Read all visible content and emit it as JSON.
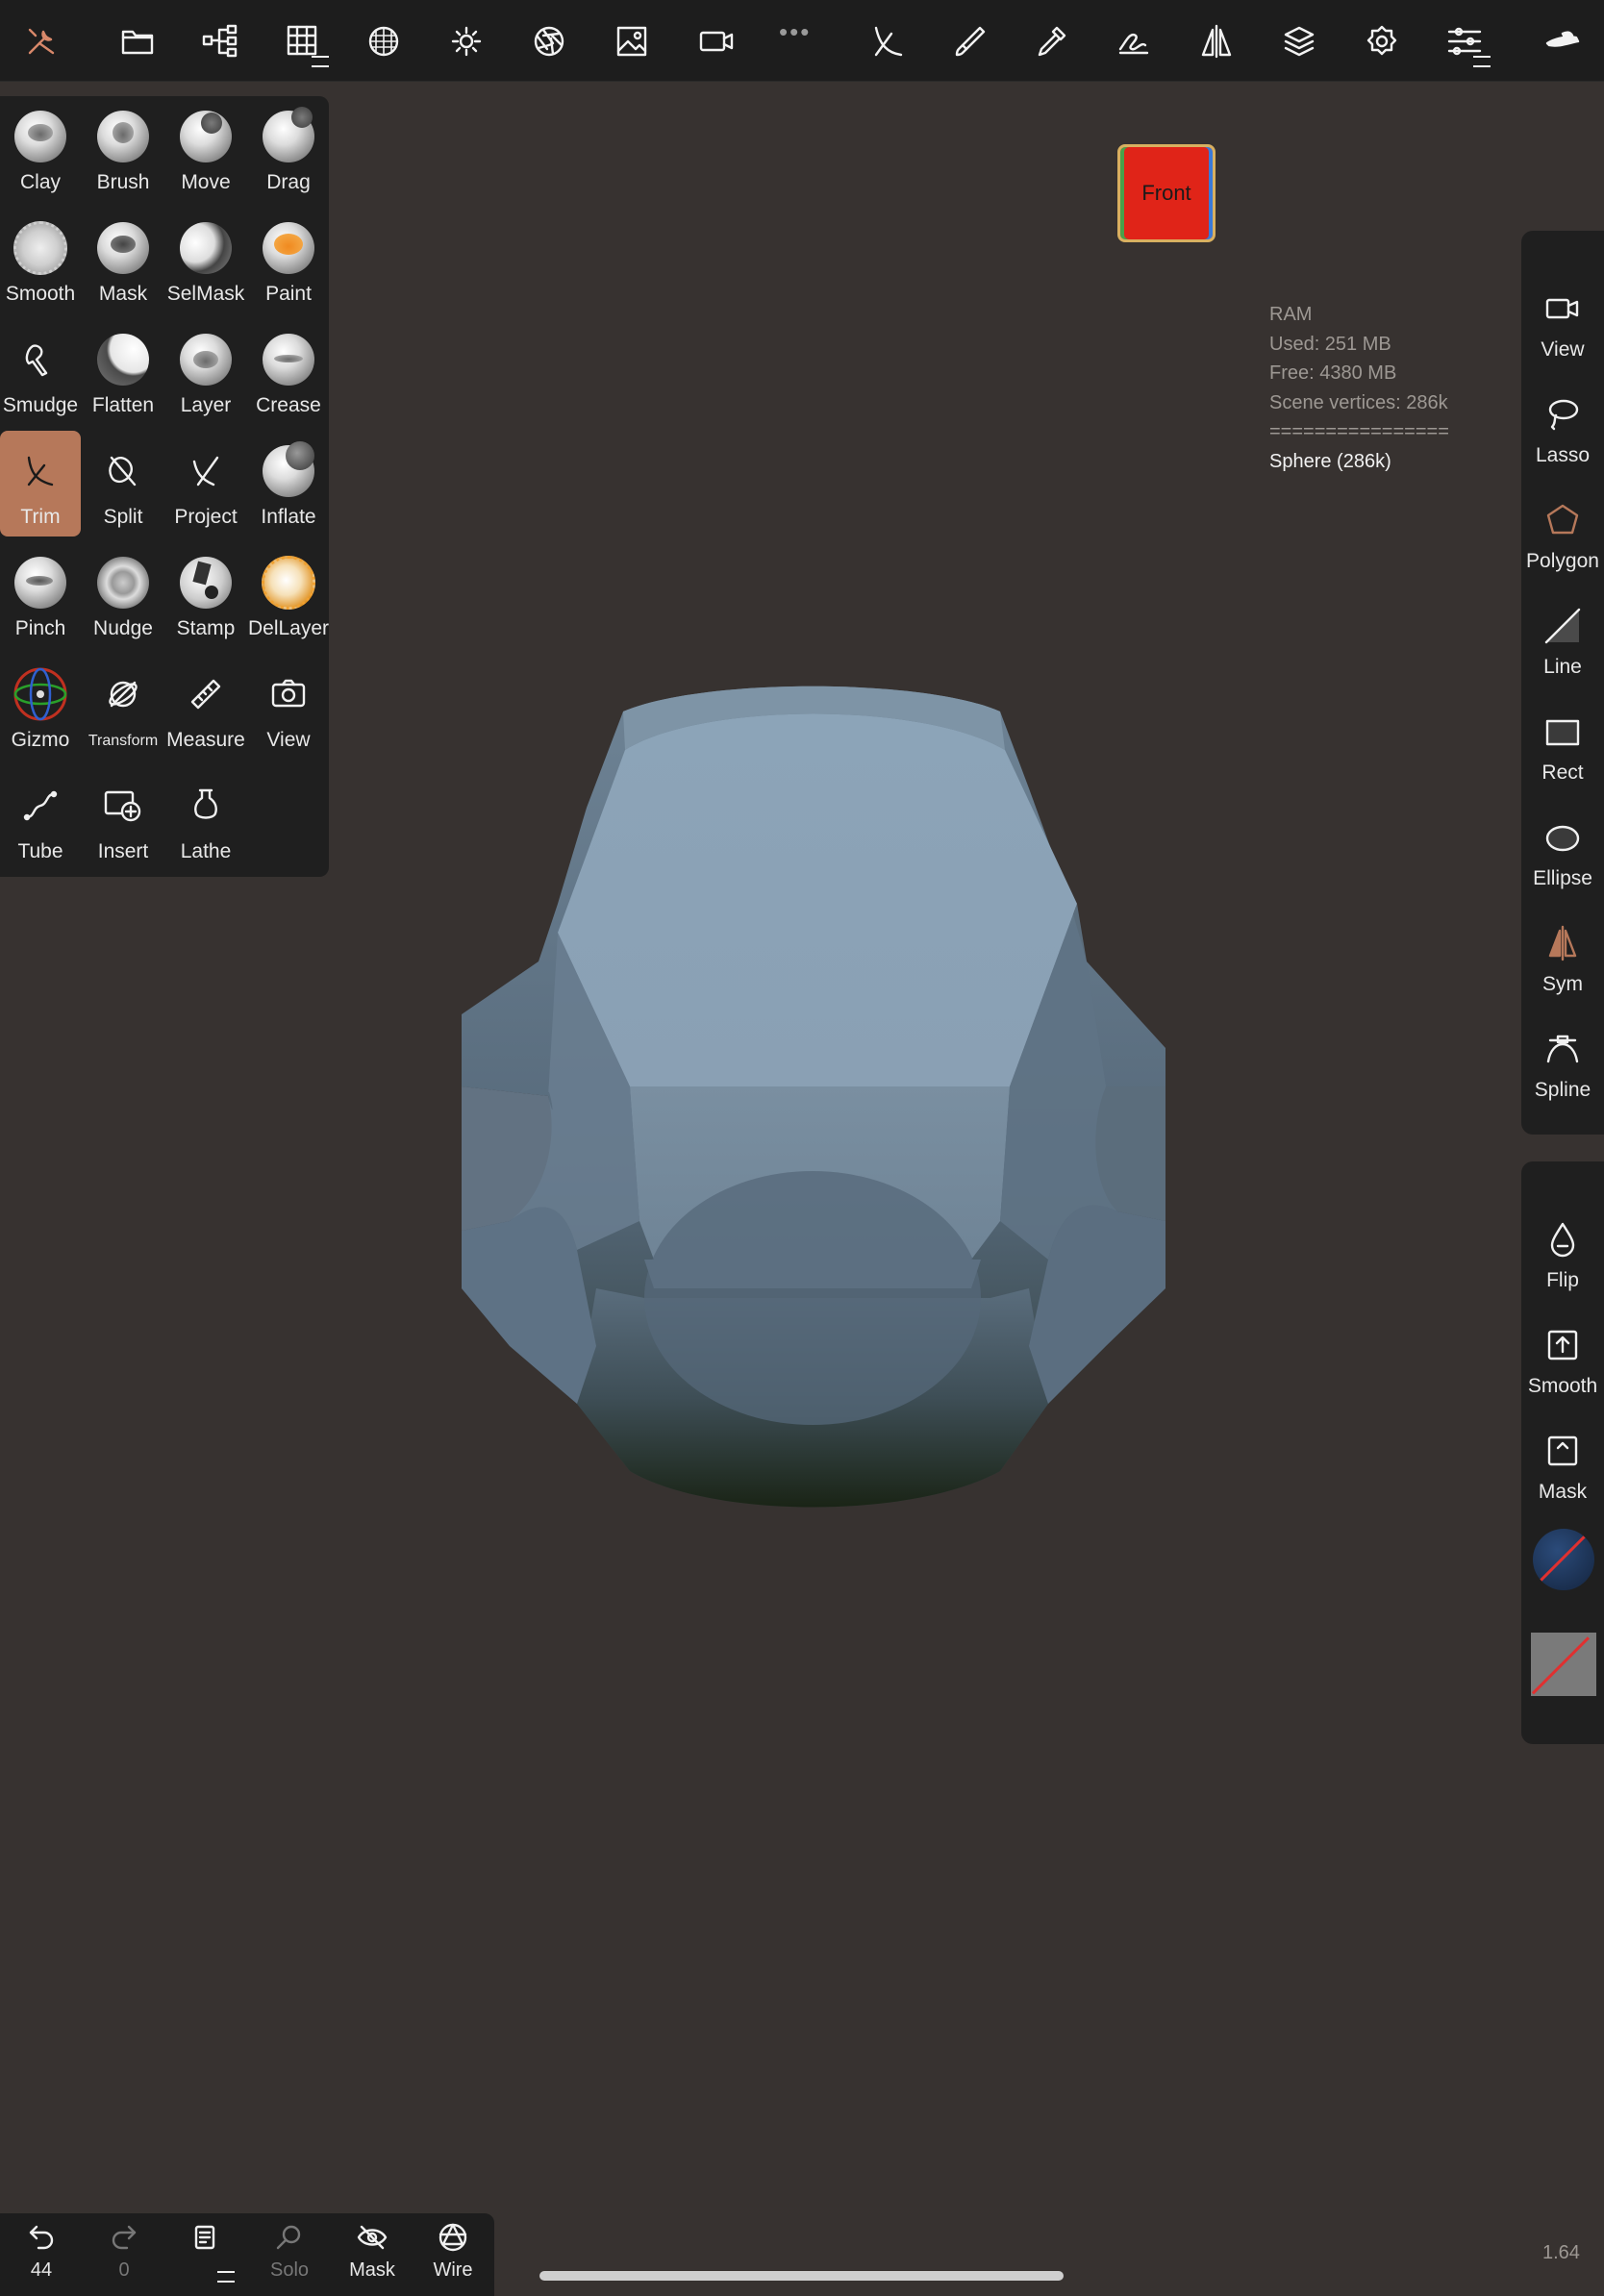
{
  "toolbar": {
    "icons": [
      "tools-icon",
      "files-icon",
      "scene-tree-icon",
      "topology-icon",
      "material-icon",
      "light-icon",
      "camera-lens-icon",
      "background-image-icon",
      "video-camera-icon",
      "more-dots-icon",
      "trim-tool-icon",
      "brush-stroke-icon",
      "paint-picker-icon",
      "stroke-settings-icon",
      "symmetry-icon",
      "layers-icon",
      "settings-icon",
      "sliders-icon",
      "app-logo-icon"
    ]
  },
  "tools": [
    {
      "label": "Clay",
      "icon": "clay-icon"
    },
    {
      "label": "Brush",
      "icon": "brush-icon"
    },
    {
      "label": "Move",
      "icon": "move-icon"
    },
    {
      "label": "Drag",
      "icon": "drag-icon"
    },
    {
      "label": "Smooth",
      "icon": "smooth-icon"
    },
    {
      "label": "Mask",
      "icon": "mask-icon"
    },
    {
      "label": "SelMask",
      "icon": "selmask-icon"
    },
    {
      "label": "Paint",
      "icon": "paint-icon"
    },
    {
      "label": "Smudge",
      "icon": "smudge-icon"
    },
    {
      "label": "Flatten",
      "icon": "flatten-icon"
    },
    {
      "label": "Layer",
      "icon": "layer-icon"
    },
    {
      "label": "Crease",
      "icon": "crease-icon"
    },
    {
      "label": "Trim",
      "icon": "trim-icon",
      "active": true
    },
    {
      "label": "Split",
      "icon": "split-icon"
    },
    {
      "label": "Project",
      "icon": "project-icon"
    },
    {
      "label": "Inflate",
      "icon": "inflate-icon"
    },
    {
      "label": "Pinch",
      "icon": "pinch-icon"
    },
    {
      "label": "Nudge",
      "icon": "nudge-icon"
    },
    {
      "label": "Stamp",
      "icon": "stamp-icon"
    },
    {
      "label": "DelLayer",
      "icon": "dellayer-icon"
    },
    {
      "label": "Gizmo",
      "icon": "gizmo-icon"
    },
    {
      "label": "Transform",
      "icon": "transform-icon"
    },
    {
      "label": "Measure",
      "icon": "ruler-icon"
    },
    {
      "label": "View",
      "icon": "camera-icon"
    },
    {
      "label": "Tube",
      "icon": "tube-icon"
    },
    {
      "label": "Insert",
      "icon": "insert-icon"
    },
    {
      "label": "Lathe",
      "icon": "lathe-icon"
    }
  ],
  "viewcube": {
    "face": "Front"
  },
  "ram": {
    "title": "RAM",
    "used": "Used: 251 MB",
    "free": "Free: 4380 MB",
    "vertices": "Scene vertices: 286k",
    "separator": "================",
    "selected": "Sphere (286k)"
  },
  "right_tools": [
    {
      "label": "View",
      "icon": "video-camera-icon"
    },
    {
      "label": "Lasso",
      "icon": "lasso-icon"
    },
    {
      "label": "Polygon",
      "icon": "polygon-icon"
    },
    {
      "label": "Line",
      "icon": "line-icon"
    },
    {
      "label": "Rect",
      "icon": "rect-icon"
    },
    {
      "label": "Ellipse",
      "icon": "ellipse-icon"
    },
    {
      "label": "Sym",
      "icon": "symmetry-icon"
    },
    {
      "label": "Spline",
      "icon": "spline-icon"
    }
  ],
  "right_actions": [
    {
      "label": "Flip",
      "icon": "drop-icon"
    },
    {
      "label": "Smooth",
      "icon": "smooth-box-icon"
    },
    {
      "label": "Mask",
      "icon": "mask-box-icon"
    }
  ],
  "colors": {
    "accent": "#b6785a",
    "viewport": "#373230",
    "panel": "#1f1f1f",
    "model": "#8aa1b4",
    "viewcube": "#e02418"
  },
  "bottom": [
    {
      "label": "44",
      "icon": "undo-icon"
    },
    {
      "label": "0",
      "icon": "redo-icon",
      "dim": true
    },
    {
      "label": "",
      "icon": "notes-icon"
    },
    {
      "label": "Solo",
      "icon": "search-icon",
      "dim": true
    },
    {
      "label": "Mask",
      "icon": "eye-slash-icon"
    },
    {
      "label": "Wire",
      "icon": "wireframe-icon"
    }
  ],
  "version": "1.64"
}
